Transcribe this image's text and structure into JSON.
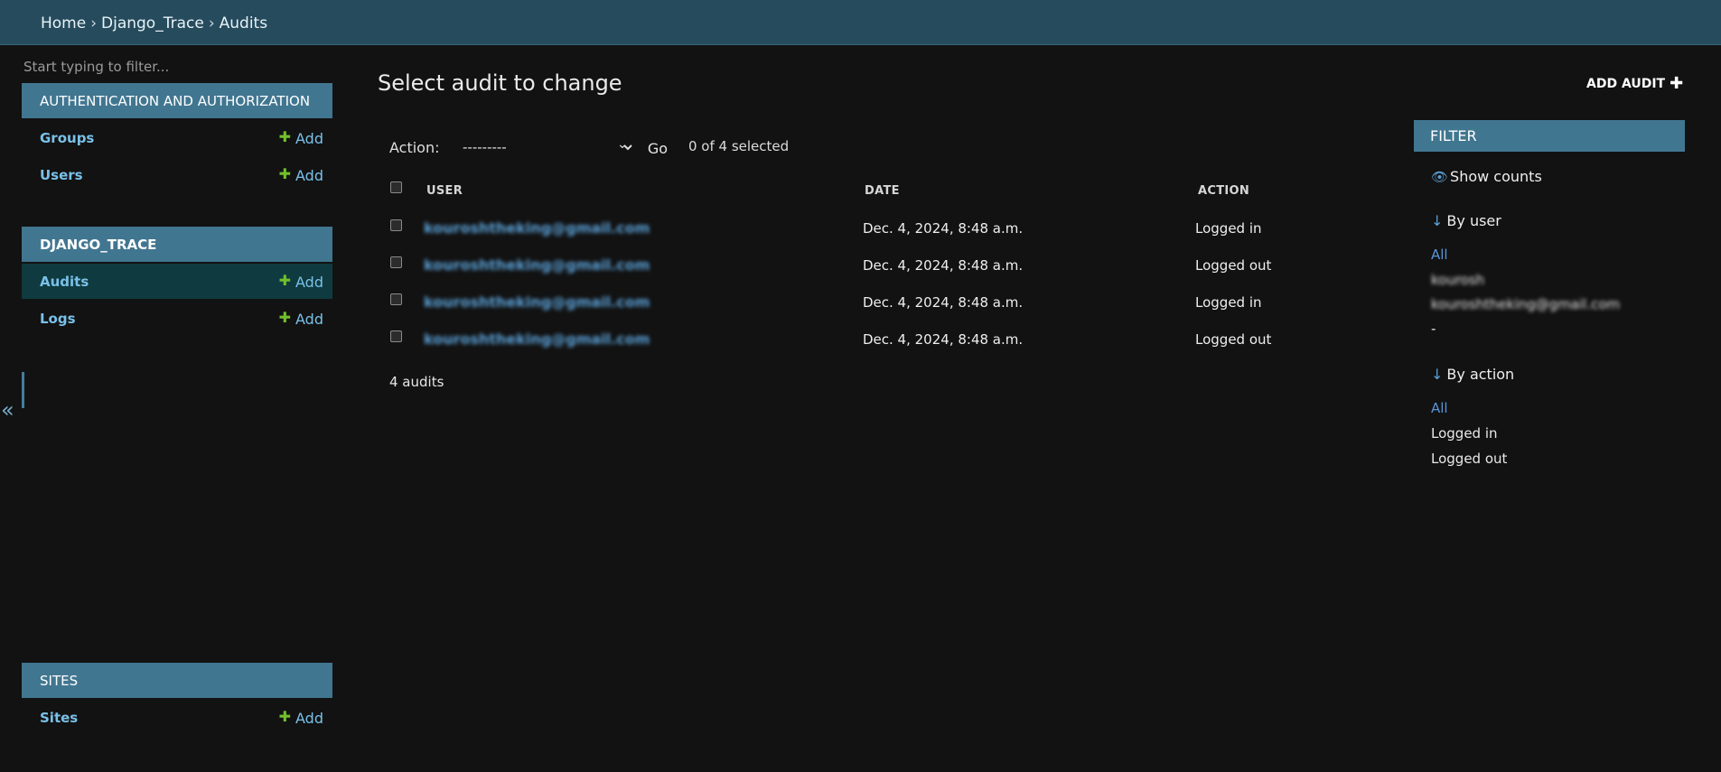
{
  "breadcrumb": {
    "home": "Home",
    "app": "Django_Trace",
    "current": "Audits",
    "separator": "›"
  },
  "sidebar": {
    "filter_placeholder": "Start typing to filter...",
    "sections": [
      {
        "title": "AUTHENTICATION AND AUTHORIZATION",
        "models": [
          {
            "name": "Groups",
            "add": "Add"
          },
          {
            "name": "Users",
            "add": "Add"
          }
        ]
      },
      {
        "title": "DJANGO_TRACE",
        "models": [
          {
            "name": "Audits",
            "add": "Add"
          },
          {
            "name": "Logs",
            "add": "Add"
          }
        ]
      },
      {
        "title": "SITES",
        "models": [
          {
            "name": "Sites",
            "add": "Add"
          }
        ]
      }
    ],
    "collapse_glyph": "«"
  },
  "main": {
    "title": "Select audit to change",
    "add_button": "ADD AUDIT",
    "action_label": "Action:",
    "action_selected": "---------",
    "go_label": "Go",
    "selected_count": "0 of 4 selected",
    "columns": [
      "USER",
      "DATE",
      "ACTION"
    ],
    "rows": [
      {
        "user": "kouroshtheking@gmail.com",
        "date": "Dec. 4, 2024, 8:48 a.m.",
        "action": "Logged in"
      },
      {
        "user": "kouroshtheking@gmail.com",
        "date": "Dec. 4, 2024, 8:48 a.m.",
        "action": "Logged out"
      },
      {
        "user": "kouroshtheking@gmail.com",
        "date": "Dec. 4, 2024, 8:48 a.m.",
        "action": "Logged in"
      },
      {
        "user": "kouroshtheking@gmail.com",
        "date": "Dec. 4, 2024, 8:48 a.m.",
        "action": "Logged out"
      }
    ],
    "result_count": "4 audits"
  },
  "filter": {
    "title": "FILTER",
    "show_counts": "Show counts",
    "groups": [
      {
        "title": "By user",
        "items": [
          "All",
          "kourosh",
          "kouroshtheking@gmail.com",
          "-"
        ]
      },
      {
        "title": "By action",
        "items": [
          "All",
          "Logged in",
          "Logged out"
        ]
      }
    ]
  },
  "colors": {
    "header_bg": "#264b5d",
    "module_header": "#417690",
    "link": "#79c1e9",
    "add_plus": "#70bf2b",
    "active_row": "#0f3a3f"
  }
}
